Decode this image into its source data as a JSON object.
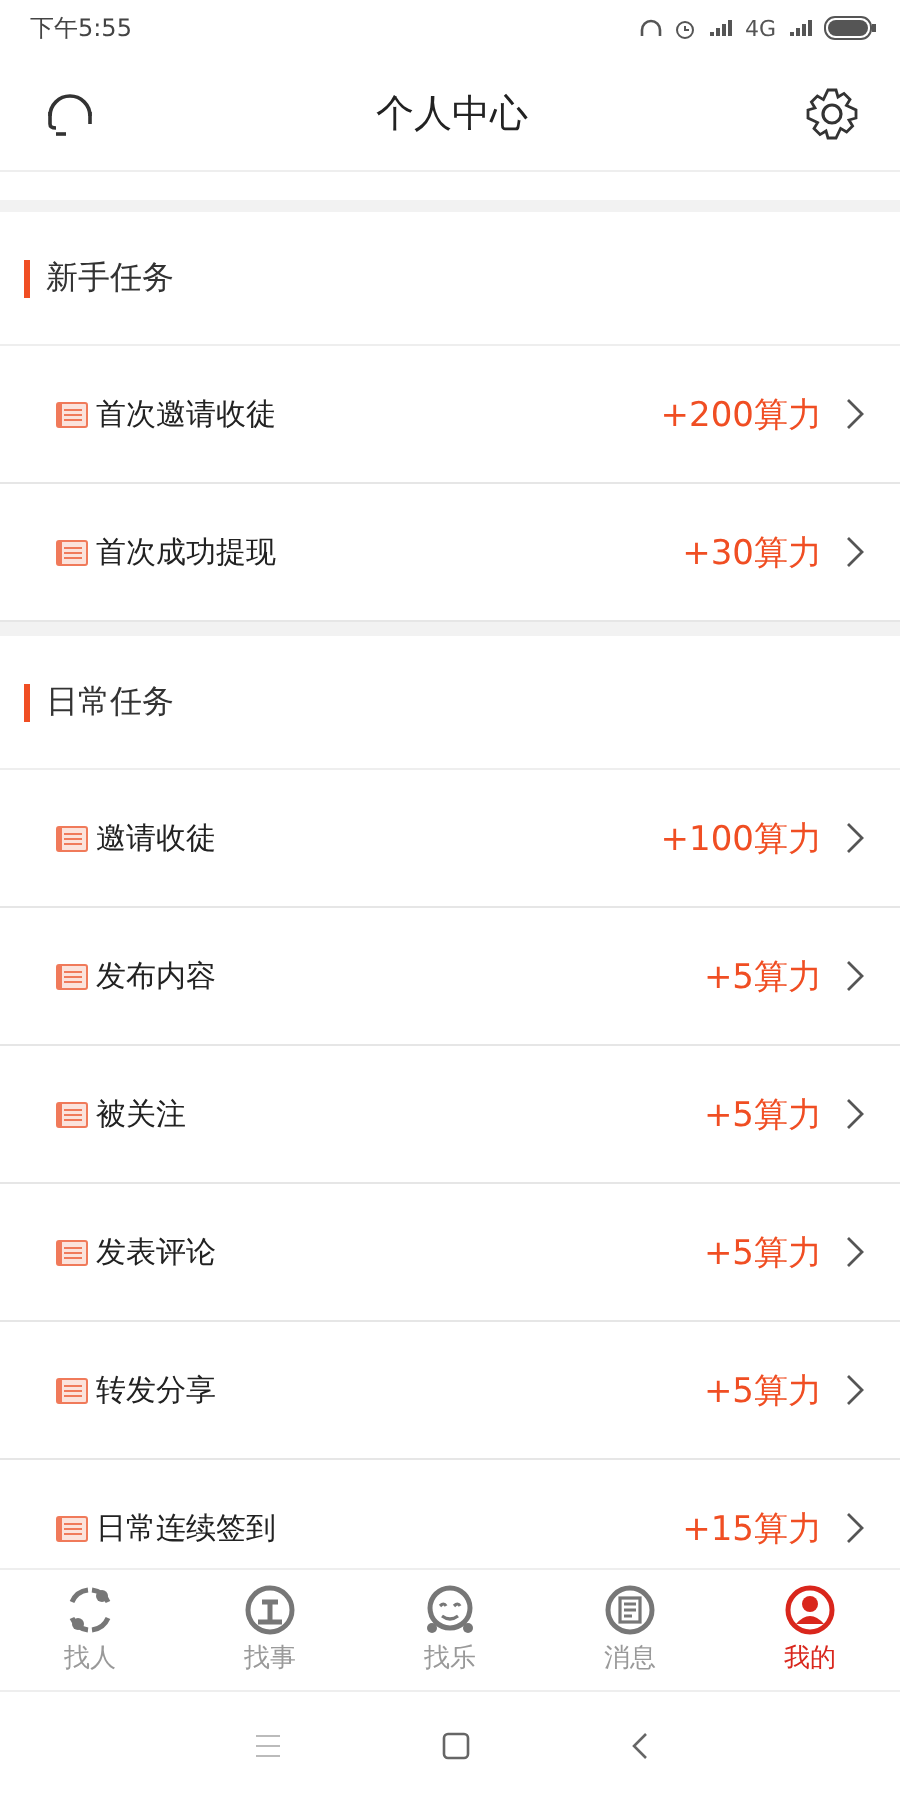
{
  "status_bar": {
    "time": "下午5:55",
    "network": "4G"
  },
  "header": {
    "title": "个人中心"
  },
  "sections": [
    {
      "title": "新手任务",
      "tasks": [
        {
          "label": "首次邀请收徒",
          "reward": "+200算力"
        },
        {
          "label": "首次成功提现",
          "reward": "+30算力"
        }
      ]
    },
    {
      "title": "日常任务",
      "tasks": [
        {
          "label": "邀请收徒",
          "reward": "+100算力"
        },
        {
          "label": "发布内容",
          "reward": "+5算力"
        },
        {
          "label": "被关注",
          "reward": "+5算力"
        },
        {
          "label": "发表评论",
          "reward": "+5算力"
        },
        {
          "label": "转发分享",
          "reward": "+5算力"
        },
        {
          "label": "日常连续签到",
          "reward": "+15算力"
        }
      ]
    }
  ],
  "tab_bar": [
    {
      "label": "找人",
      "kind": "hearts",
      "selected": false
    },
    {
      "label": "找事",
      "kind": "plant",
      "selected": false
    },
    {
      "label": "找乐",
      "kind": "smile",
      "selected": false
    },
    {
      "label": "消息",
      "kind": "note",
      "selected": false
    },
    {
      "label": "我的",
      "kind": "person",
      "selected": true
    }
  ]
}
